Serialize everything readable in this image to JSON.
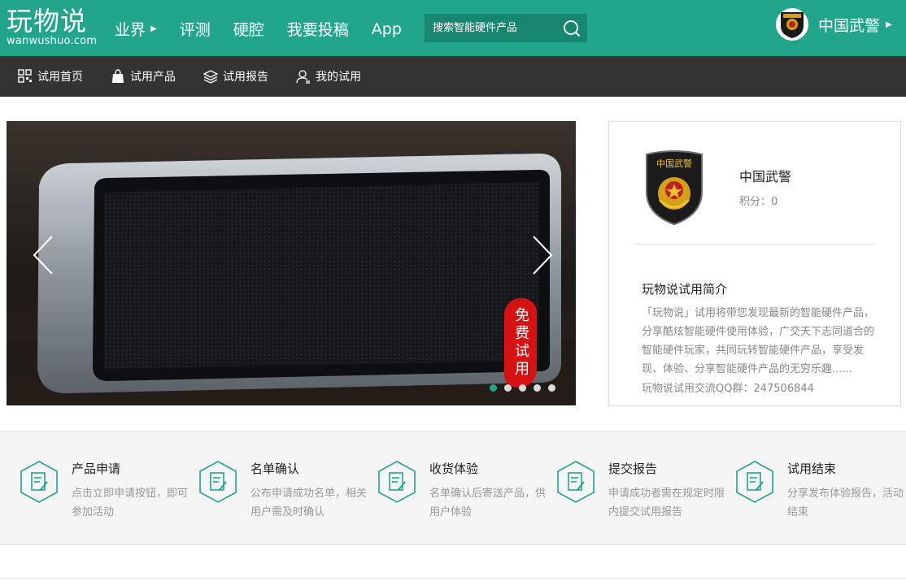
{
  "header": {
    "logo_cn": "玩物说",
    "logo_en": "wanwushuo.com",
    "nav": [
      {
        "label": "业界",
        "has_arrow": true
      },
      {
        "label": "评测"
      },
      {
        "label": "硬腔"
      },
      {
        "label": "我要投稿"
      },
      {
        "label": "App"
      }
    ],
    "search_placeholder": "搜索智能硬件产品",
    "username": "中国武警"
  },
  "subnav": [
    {
      "label": "试用首页",
      "icon": "grid-icon"
    },
    {
      "label": "试用产品",
      "icon": "bag-icon"
    },
    {
      "label": "试用报告",
      "icon": "layers-icon"
    },
    {
      "label": "我的试用",
      "icon": "user-icon"
    }
  ],
  "banner": {
    "stamp_text": "免费试用",
    "dots": 5,
    "active_dot": 0
  },
  "profile": {
    "badge_text": "中国武警",
    "name": "中国武警",
    "points": "积分：0",
    "intro_title": "玩物说试用简介",
    "intro_text": "「玩物说」试用将带您发现最新的智能硬件产品，分享酷炫智能硬件使用体验，广交天下志同道合的智能硬件玩家，共同玩转智能硬件产品，享受发现、体验、分享智能硬件产品的无穷乐趣......",
    "qq": "玩物说试用交流QQ群：247506844"
  },
  "steps": [
    {
      "title": "产品申请",
      "desc": "点击立即申请按钮，即可参加活动"
    },
    {
      "title": "名单确认",
      "desc": "公布申请成功名单，相关用户需及时确认"
    },
    {
      "title": "收货体验",
      "desc": "名单确认后寄送产品，供用户体验"
    },
    {
      "title": "提交报告",
      "desc": "申请成功者需在规定时限内提交试用报告"
    },
    {
      "title": "试用结束",
      "desc": "分享发布体验报告，活动结束"
    }
  ],
  "colors": {
    "brand": "#21a68c",
    "subnav_bg": "#333333"
  }
}
